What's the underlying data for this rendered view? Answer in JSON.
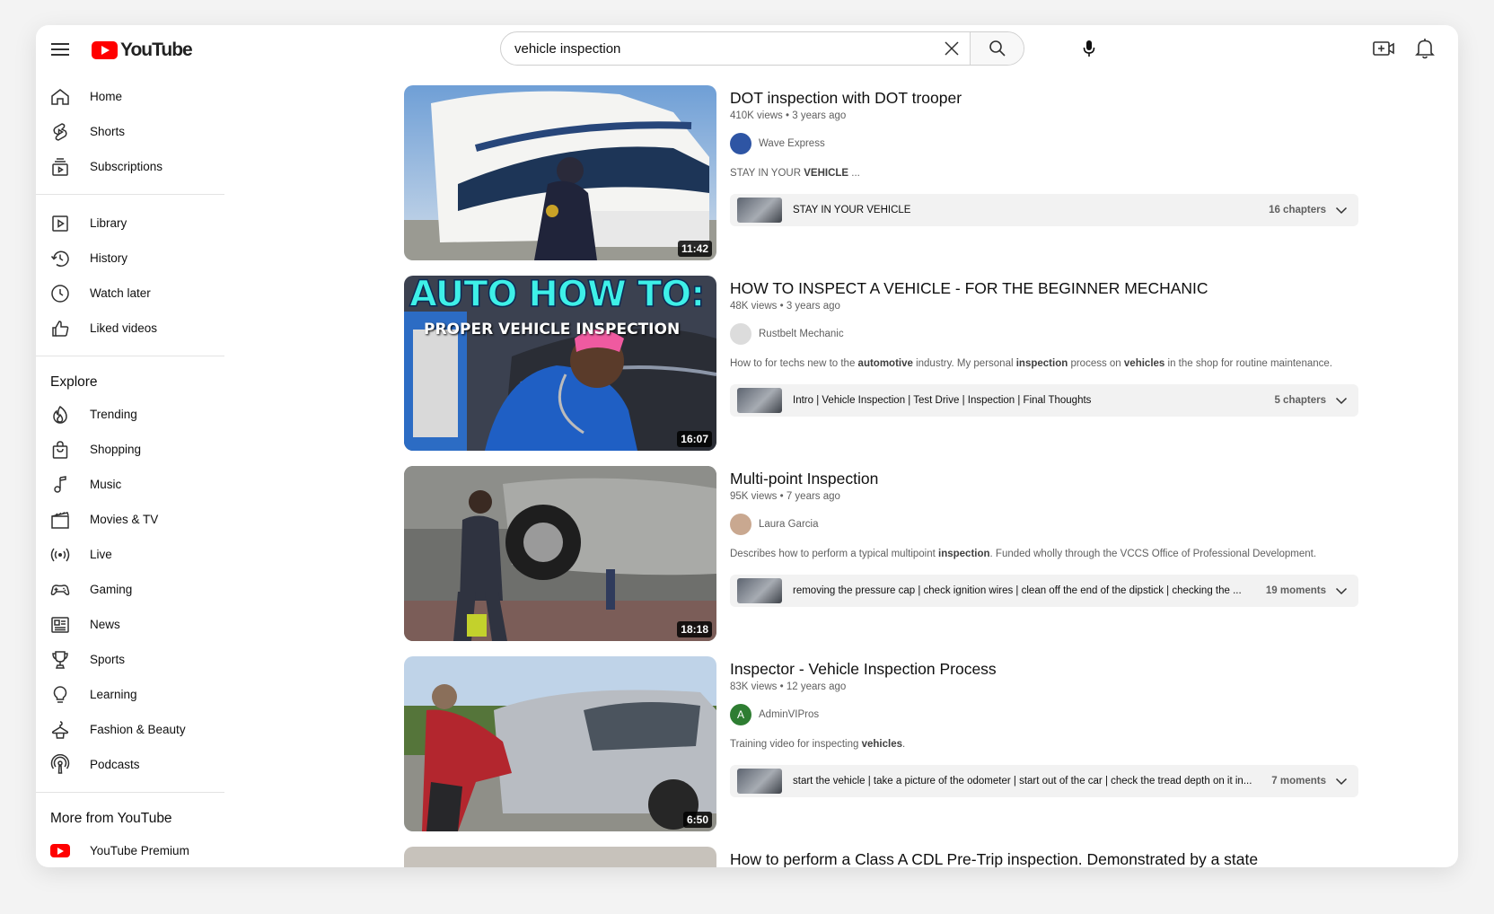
{
  "header": {
    "logo": "YouTube",
    "search_value": "vehicle inspection",
    "icons": [
      "menu-icon",
      "clear-icon",
      "search-icon",
      "mic-icon",
      "create-icon",
      "bell-icon"
    ]
  },
  "sidebar": {
    "main": [
      {
        "label": "Home",
        "icon": "home-icon"
      },
      {
        "label": "Shorts",
        "icon": "shorts-icon"
      },
      {
        "label": "Subscriptions",
        "icon": "subscriptions-icon"
      }
    ],
    "library": [
      {
        "label": "Library",
        "icon": "library-icon"
      },
      {
        "label": "History",
        "icon": "history-icon"
      },
      {
        "label": "Watch later",
        "icon": "watch-later-icon"
      },
      {
        "label": "Liked videos",
        "icon": "liked-videos-icon"
      }
    ],
    "explore_title": "Explore",
    "explore": [
      {
        "label": "Trending",
        "icon": "trending-icon"
      },
      {
        "label": "Shopping",
        "icon": "shopping-icon"
      },
      {
        "label": "Music",
        "icon": "music-icon"
      },
      {
        "label": "Movies & TV",
        "icon": "movies-icon"
      },
      {
        "label": "Live",
        "icon": "live-icon"
      },
      {
        "label": "Gaming",
        "icon": "gaming-icon"
      },
      {
        "label": "News",
        "icon": "news-icon"
      },
      {
        "label": "Sports",
        "icon": "sports-icon"
      },
      {
        "label": "Learning",
        "icon": "learning-icon"
      },
      {
        "label": "Fashion & Beauty",
        "icon": "fashion-icon"
      },
      {
        "label": "Podcasts",
        "icon": "podcasts-icon"
      }
    ],
    "more_title": "More from YouTube",
    "more": [
      {
        "label": "YouTube Premium",
        "icon": "youtube-premium-icon"
      }
    ]
  },
  "results": [
    {
      "title": "DOT inspection with DOT trooper",
      "meta": "410K views • 3 years ago",
      "channel": "Wave Express",
      "desc_parts": [
        "STAY IN YOUR ",
        "VEHICLE",
        " ..."
      ],
      "chapters_text": "STAY IN YOUR VEHICLE",
      "chapters_count": "16 chapters",
      "duration": "11:42"
    },
    {
      "title": "HOW TO INSPECT A VEHICLE - FOR THE BEGINNER MECHANIC",
      "meta": "48K views • 3 years ago",
      "channel": "Rustbelt Mechanic",
      "desc_parts": [
        "How to for techs new to the ",
        "automotive",
        " industry. My personal ",
        "inspection",
        " process on ",
        "vehicles",
        " in the shop for routine maintenance."
      ],
      "chapters_text": "Intro | Vehicle Inspection | Test Drive | Inspection | Final Thoughts",
      "chapters_count": "5 chapters",
      "duration": "16:07",
      "thumb_text_1": "AUTO HOW TO:",
      "thumb_text_2": "PROPER VEHICLE INSPECTION"
    },
    {
      "title": "Multi-point Inspection",
      "meta": "95K views • 7 years ago",
      "channel": "Laura Garcia",
      "desc_parts": [
        "Describes how to perform a typical multipoint ",
        "inspection",
        ". Funded wholly through the VCCS Office of Professional Development."
      ],
      "chapters_text": "removing the pressure cap | check ignition wires | clean off the end of the dipstick | checking the ...",
      "chapters_count": "19 moments",
      "duration": "18:18"
    },
    {
      "title": "Inspector - Vehicle Inspection Process",
      "meta": "83K views • 12 years ago",
      "channel": "AdminVIPros",
      "avatar_letter": "A",
      "desc_parts": [
        "Training video for inspecting ",
        "vehicles",
        "."
      ],
      "chapters_text": "start the vehicle | take a picture of the odometer | start out of the car | check the tread depth on it in...",
      "chapters_count": "7 moments",
      "duration": "6:50"
    },
    {
      "title": "How to perform a Class A CDL Pre-Trip inspection. Demonstrated by a state"
    }
  ]
}
